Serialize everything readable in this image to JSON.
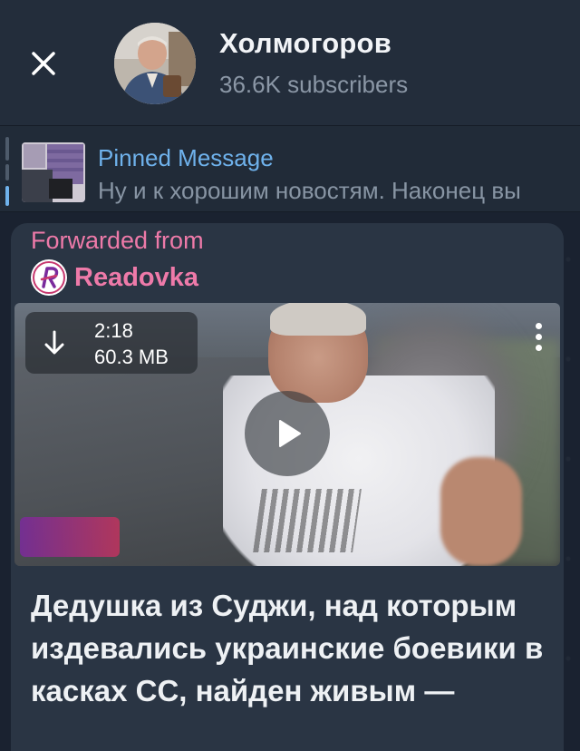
{
  "header": {
    "close_icon": "close-icon",
    "channel_name": "Холмогоров",
    "subscribers": "36.6K subscribers"
  },
  "pinned": {
    "title": "Pinned Message",
    "text": "Ну и к хорошим новостям. Наконец вы",
    "accent_color": "#6fb2ec"
  },
  "message": {
    "forwarded_label": "Forwarded from",
    "forwarded_source": "Readovka",
    "accent_color": "#ee7aa9",
    "video": {
      "duration": "2:18",
      "size": "60.3 MB",
      "download_icon": "download-icon",
      "play_icon": "play-icon",
      "more_icon": "more-vertical-icon"
    },
    "text": "Дедушка из Суджи, над которым издевались украинские боевики в касках СС, найден живым —"
  },
  "colors": {
    "background": "#1a2230",
    "header": "#232d3b",
    "bubble": "#2a3544"
  }
}
